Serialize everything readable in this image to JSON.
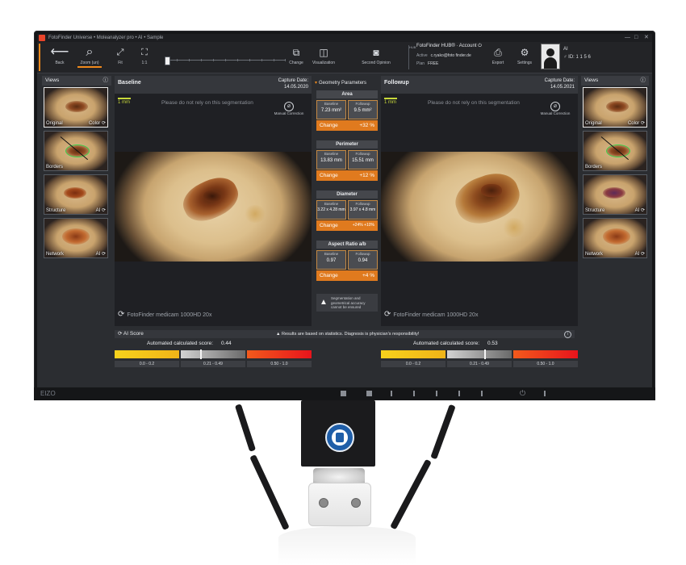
{
  "titlebar": {
    "title": "FotoFinder Universe  •  Moleanalyzer pro  •  AI  •  Sample",
    "minimize": "—",
    "maximize": "□",
    "close": "✕"
  },
  "toolbar": {
    "back": "Back",
    "zoom": "Zoom (un)",
    "fit": "Fit",
    "one_to_one": "1:1",
    "change": "Change",
    "visualization": "Visualization",
    "second_opinion": "Second Opinion",
    "export": "Export",
    "settings": "Settings"
  },
  "account": {
    "hub": "FotoFinder HUB®  ·  Account  ⏻",
    "active_label": "Active",
    "active_value": "c.ryako@foto finder.de",
    "plan_label": "Plan",
    "plan_value": "FREE",
    "sync_badge": "HUB"
  },
  "patient": {
    "initials": "AI",
    "id": "ID: 1 1 5 6",
    "gender_icon": "male-icon"
  },
  "views_left": {
    "title": "Views",
    "items": [
      {
        "label": "Original",
        "right": "Color"
      },
      {
        "label": "Borders",
        "right": ""
      },
      {
        "label": "Structure",
        "right": "AI"
      },
      {
        "label": "Network",
        "right": "AI"
      }
    ]
  },
  "views_right": {
    "title": "Views",
    "items": [
      {
        "label": "Original",
        "right": "Color"
      },
      {
        "label": "Borders",
        "right": ""
      },
      {
        "label": "Structure",
        "right": "AI"
      },
      {
        "label": "Network",
        "right": "AI"
      }
    ]
  },
  "baseline": {
    "title": "Baseline",
    "capture_label": "Capture Date:",
    "capture_date": "14.05.2020",
    "scale": "1 mm",
    "warning": "Please do not rely on this segmentation",
    "manual": "Manual Correction",
    "device": "FotoFinder medicam 1000HD 20x"
  },
  "followup": {
    "title": "Followup",
    "capture_label": "Capture Date:",
    "capture_date": "14.05.2021",
    "scale": "1 mm",
    "warning": "Please do not rely on this segmentation",
    "manual": "Manual Correction",
    "device": "FotoFinder medicam 1000HD 20x"
  },
  "geometry": {
    "header": "Geometry Parameters",
    "blocks": [
      {
        "title": "Area",
        "baseline_label": "Baseline",
        "baseline": "7.23 mm²",
        "followup_label": "Followup",
        "followup": "9.5 mm²",
        "change_label": "Change",
        "change": "+32 %"
      },
      {
        "title": "Perimeter",
        "baseline_label": "Baseline",
        "baseline": "13.83 mm",
        "followup_label": "Followup",
        "followup": "15.51 mm",
        "change_label": "Change",
        "change": "+12 %"
      },
      {
        "title": "Diameter",
        "baseline_label": "Baseline",
        "baseline": "3.22 x 4.28 mm",
        "followup_label": "Followup",
        "followup": "3.97 x 4.8 mm",
        "change_label": "Change",
        "change": "+24% +10%"
      },
      {
        "title": "Aspect Ratio a/b",
        "baseline_label": "Baseline",
        "baseline": "0.97",
        "followup_label": "Followup",
        "followup": "0.94",
        "change_label": "Change",
        "change": "+4 %"
      }
    ],
    "note": "Segmentation and geometrical accuracy cannot be ensured"
  },
  "ai": {
    "title": "AI Score",
    "message": "Results are based on statistics. Diagnosis is physician's responsibility!",
    "baseline": {
      "label": "Automated calculated score:",
      "value": "0.44",
      "score": 0.44
    },
    "followup": {
      "label": "Automated calculated score:",
      "value": "0.53",
      "score": 0.53
    },
    "ranges": [
      "0.0 - 0.2",
      "0.21 - 0.49",
      "0.50 - 1.0"
    ],
    "colors": {
      "low": "#f2c318",
      "mid": "#a2a2a2",
      "high": "#e8261c"
    }
  },
  "monitor": {
    "brand": "EIZO"
  },
  "colors": {
    "accent": "#f08a1c",
    "change": "#e07a1e"
  }
}
